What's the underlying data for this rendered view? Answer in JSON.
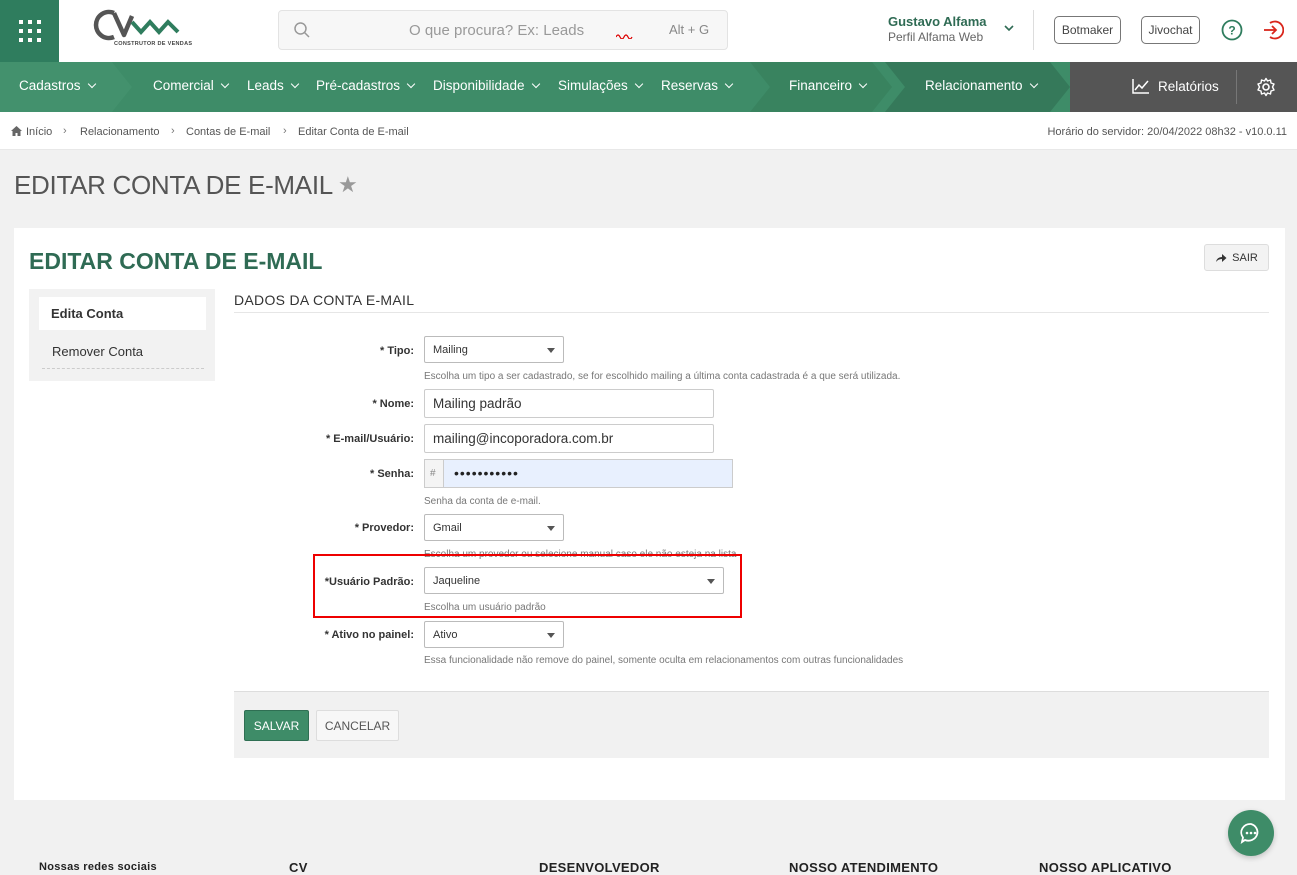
{
  "header": {
    "logo_text": "CV",
    "logo_sub": "CONSTRUTOR DE VENDAS",
    "search_placeholder": "O que procura? Ex: Leads",
    "search_shortcut": "Alt + G",
    "user_name": "Gustavo Alfama",
    "user_profile": "Perfil Alfama Web",
    "btn_botmaker": "Botmaker",
    "btn_jivochat": "Jivochat"
  },
  "nav": {
    "items": [
      "Cadastros",
      "Comercial",
      "Leads",
      "Pré-cadastros",
      "Disponibilidade",
      "Simulações",
      "Reservas",
      "Financeiro",
      "Relacionamento"
    ],
    "reports": "Relatórios"
  },
  "breadcrumb": {
    "items": [
      "Início",
      "Relacionamento",
      "Contas de E-mail",
      "Editar Conta de E-mail"
    ],
    "server_time": "Horário do servidor: 20/04/2022 08h32 - v10.0.11"
  },
  "page": {
    "title": "EDITAR CONTA DE E-MAIL",
    "card_title": "EDITAR CONTA DE E-MAIL",
    "exit_label": "SAIR",
    "side_menu": [
      "Edita Conta",
      "Remover Conta"
    ],
    "section_title": "DADOS DA CONTA E-MAIL"
  },
  "form": {
    "tipo_label": "* Tipo:",
    "tipo_value": "Mailing",
    "tipo_help": "Escolha um tipo a ser cadastrado, se for escolhido mailing a última conta cadastrada é a que será utilizada.",
    "nome_label": "* Nome:",
    "nome_value": "Mailing padrão",
    "email_label": "* E-mail/Usuário:",
    "email_value": "mailing@incoporadora.com.br",
    "senha_label": "* Senha:",
    "senha_prefix": "#",
    "senha_value": "•••••••••••",
    "senha_help": "Senha da conta de e-mail.",
    "provedor_label": "* Provedor:",
    "provedor_value": "Gmail",
    "provedor_help": "Escolha um provedor ou selecione manual caso ele não esteja na lista",
    "usuario_label": "*Usuário Padrão:",
    "usuario_value": "Jaqueline",
    "usuario_help": "Escolha um usuário padrão",
    "ativo_label": "* Ativo no painel:",
    "ativo_value": "Ativo",
    "ativo_help": "Essa funcionalidade não remove do painel, somente oculta em relacionamentos com outras funcionalidades",
    "save_label": "SALVAR",
    "cancel_label": "CANCELAR"
  },
  "footer": {
    "social": "Nossas redes sociais",
    "cv": "CV",
    "dev": "DESENVOLVEDOR",
    "support": "NOSSO ATENDIMENTO",
    "app": "NOSSO APLICATIVO"
  },
  "colors": {
    "brand_green": "#3e8c68",
    "dark_green": "#2f6b54",
    "highlight_red": "#ee0000"
  }
}
